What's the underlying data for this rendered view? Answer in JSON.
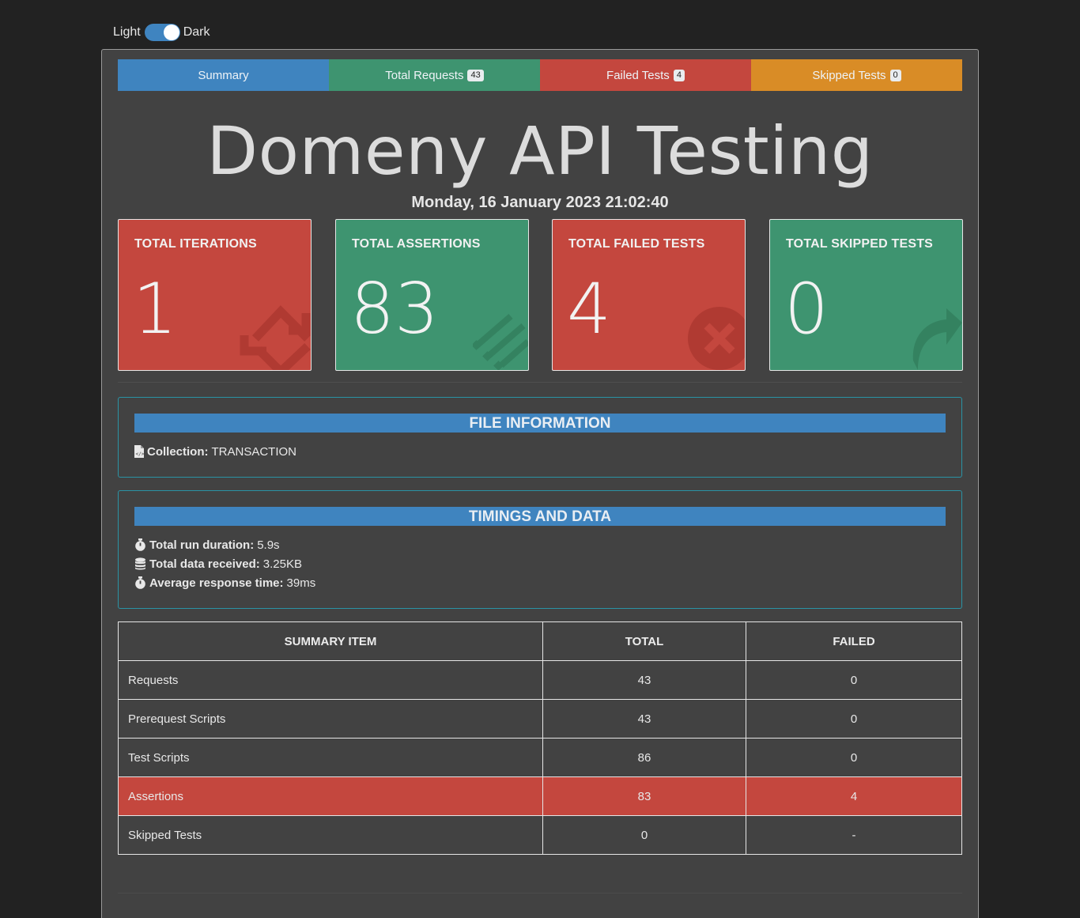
{
  "theme": {
    "light_label": "Light",
    "dark_label": "Dark"
  },
  "tabs": [
    {
      "label": "Summary"
    },
    {
      "label": "Total Requests",
      "badge": "43"
    },
    {
      "label": "Failed Tests",
      "badge": "4"
    },
    {
      "label": "Skipped Tests",
      "badge": "0"
    }
  ],
  "header": {
    "title": "Domeny API Testing",
    "date": "Monday, 16 January 2023 21:02:40"
  },
  "cards": [
    {
      "label": "TOTAL ITERATIONS",
      "value": "1",
      "icon": "sync-icon",
      "color": "#c4473e"
    },
    {
      "label": "TOTAL ASSERTIONS",
      "value": "83",
      "icon": "tasks-icon",
      "color": "#3e9470"
    },
    {
      "label": "TOTAL FAILED TESTS",
      "value": "4",
      "icon": "times-circle-icon",
      "color": "#c4473e"
    },
    {
      "label": "TOTAL SKIPPED TESTS",
      "value": "0",
      "icon": "share-icon",
      "color": "#3e9470"
    }
  ],
  "file_info": {
    "heading": "FILE INFORMATION",
    "collection_label": "Collection:",
    "collection_value": "TRANSACTION"
  },
  "timings": {
    "heading": "TIMINGS AND DATA",
    "rows": [
      {
        "label": "Total run duration:",
        "value": "5.9s",
        "icon": "stopwatch-icon"
      },
      {
        "label": "Total data received:",
        "value": "3.25KB",
        "icon": "database-icon"
      },
      {
        "label": "Average response time:",
        "value": "39ms",
        "icon": "stopwatch-icon"
      }
    ]
  },
  "summary_table": {
    "columns": [
      "SUMMARY ITEM",
      "TOTAL",
      "FAILED"
    ],
    "rows": [
      {
        "item": "Requests",
        "total": "43",
        "failed": "0"
      },
      {
        "item": "Prerequest Scripts",
        "total": "43",
        "failed": "0"
      },
      {
        "item": "Test Scripts",
        "total": "86",
        "failed": "0"
      },
      {
        "item": "Assertions",
        "total": "83",
        "failed": "4"
      },
      {
        "item": "Skipped Tests",
        "total": "0",
        "failed": "-"
      }
    ]
  },
  "colors": {
    "accent_blue": "#3f84bf",
    "success_green": "#3e9470",
    "danger_red": "#c4473e",
    "warning_orange": "#d98c26"
  }
}
